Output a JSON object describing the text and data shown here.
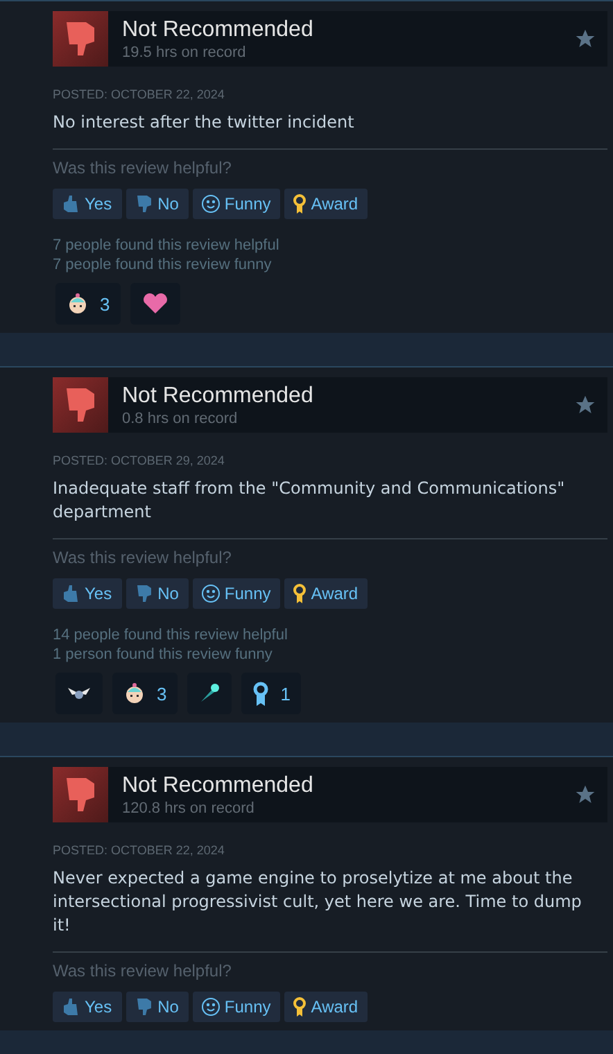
{
  "reviews": [
    {
      "verdict": "Not Recommended",
      "hours": "19.5 hrs on record",
      "posted": "POSTED: OCTOBER 22, 2024",
      "text": "No interest after the twitter incident",
      "question": "Was this review helpful?",
      "buttons": [
        {
          "kind": "yes",
          "label": "Yes"
        },
        {
          "kind": "no",
          "label": "No"
        },
        {
          "kind": "funny",
          "label": "Funny"
        },
        {
          "kind": "award",
          "label": "Award"
        }
      ],
      "stats": [
        "7 people found this review helpful",
        "7 people found this review funny"
      ],
      "reactions": [
        {
          "kind": "baby",
          "count": "3"
        },
        {
          "kind": "heart"
        }
      ]
    },
    {
      "verdict": "Not Recommended",
      "hours": "0.8 hrs on record",
      "posted": "POSTED: OCTOBER 29, 2024",
      "text": "Inadequate staff from the \"Community and Communications\" department",
      "question": "Was this review helpful?",
      "buttons": [
        {
          "kind": "yes",
          "label": "Yes"
        },
        {
          "kind": "no",
          "label": "No"
        },
        {
          "kind": "funny",
          "label": "Funny"
        },
        {
          "kind": "award",
          "label": "Award"
        }
      ],
      "stats": [
        "14 people found this review helpful",
        "1 person found this review funny"
      ],
      "reactions": [
        {
          "kind": "wings"
        },
        {
          "kind": "baby",
          "count": "3"
        },
        {
          "kind": "comet"
        },
        {
          "kind": "ribbon",
          "count": "1"
        }
      ]
    },
    {
      "verdict": "Not Recommended",
      "hours": "120.8 hrs on record",
      "posted": "POSTED: OCTOBER 22, 2024",
      "text": "Never expected a game engine to proselytize at me about the intersectional progressivist cult, yet here we are. Time to dump it!",
      "question": "Was this review helpful?",
      "buttons": [
        {
          "kind": "yes",
          "label": "Yes"
        },
        {
          "kind": "no",
          "label": "No"
        },
        {
          "kind": "funny",
          "label": "Funny"
        },
        {
          "kind": "award",
          "label": "Award"
        }
      ]
    }
  ]
}
